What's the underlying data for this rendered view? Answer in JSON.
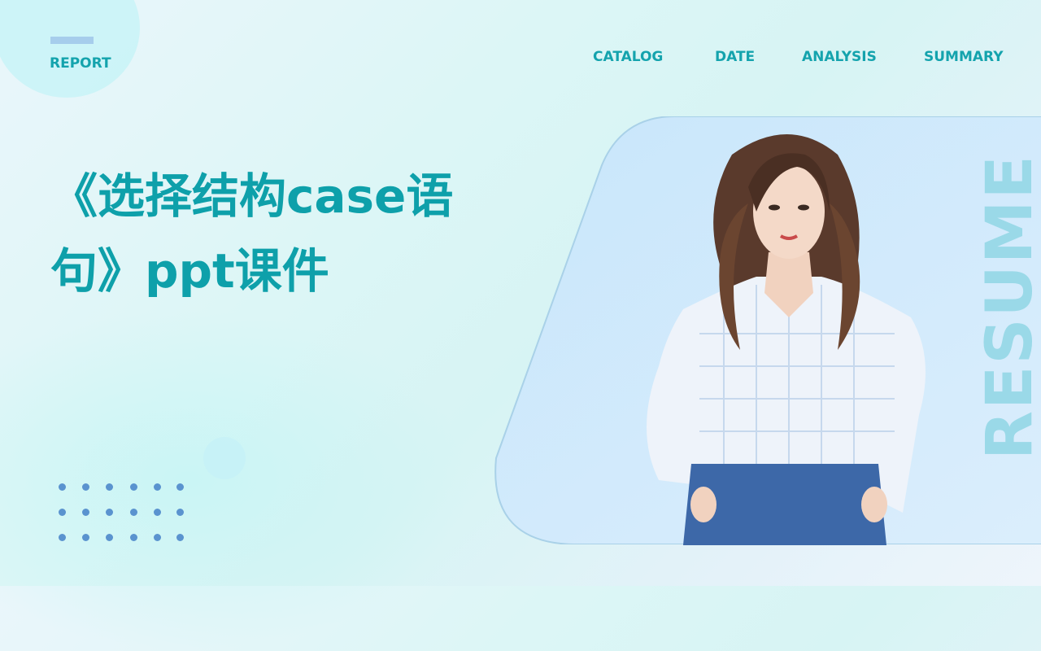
{
  "header": {
    "report_label": "REPORT",
    "nav": [
      {
        "label": "CATALOG"
      },
      {
        "label": "DATE"
      },
      {
        "label": "ANALYSIS"
      },
      {
        "label": "SUMMARY"
      }
    ]
  },
  "main": {
    "title_line1": "《选择结构case语",
    "title_line2": "句》ppt课件",
    "side_label": "RESUME",
    "image_description": "woman in white ruffled plaid blouse and blue jeans"
  },
  "colors": {
    "accent": "#14a3ad",
    "title": "#0ea0aa",
    "dots": "#5a93cf",
    "panel": "#cfe8fb",
    "side_label": "#9ad9e8"
  }
}
